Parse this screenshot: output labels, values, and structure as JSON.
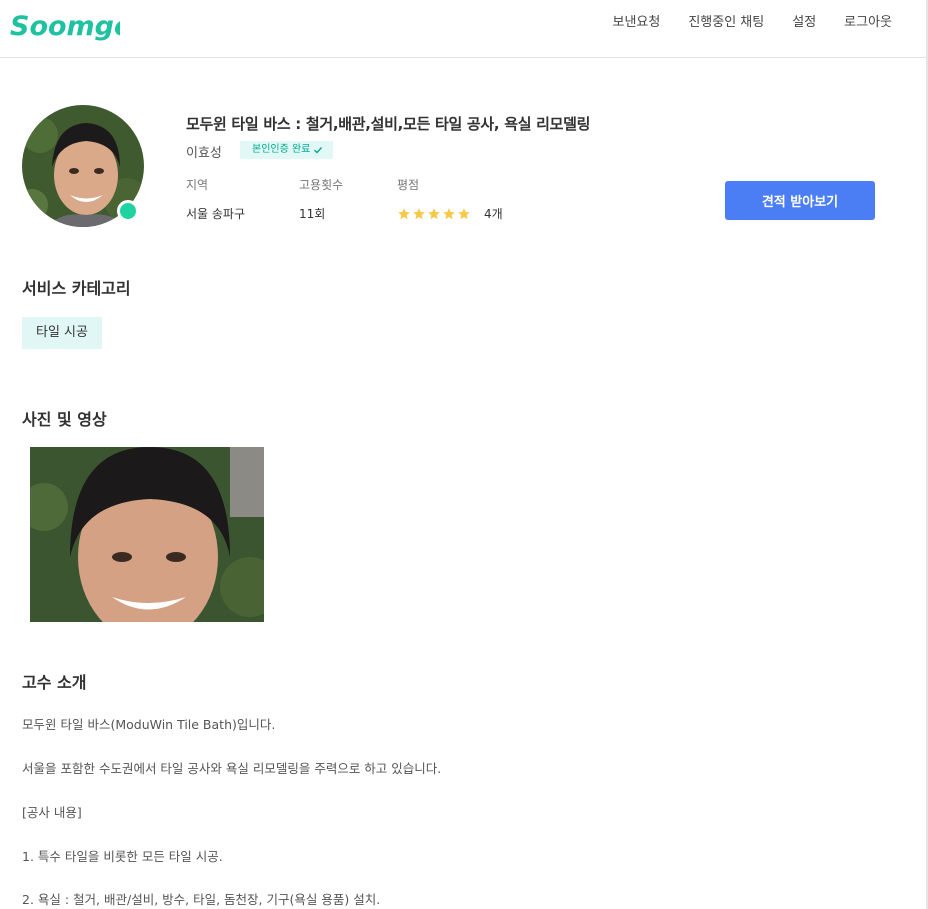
{
  "header": {
    "logo_text": "Soomgo",
    "nav": [
      "보낸요청",
      "진행중인 채팅",
      "설정",
      "로그아웃"
    ]
  },
  "profile": {
    "title": "모두윈 타일 바스 : 철거,배관,설비,모든 타일 공사, 욕실 리모델링",
    "name": "이효성",
    "verify_label": "본인인증 완료",
    "stats": {
      "region_label": "지역",
      "region_value": "서울 송파구",
      "hires_label": "고용횟수",
      "hires_value": "11회",
      "rating_label": "평점",
      "rating_stars": 5,
      "review_count": "4개"
    },
    "quote_button": "견적 받아보기"
  },
  "sections": {
    "category_title": "서비스 카테고리",
    "category_chip": "타일 시공",
    "media_title": "사진 및 영상",
    "intro_title": "고수 소개"
  },
  "intro_lines": [
    "모두윈 타일 바스(ModuWin Tile Bath)입니다.",
    "서울을 포함한 수도권에서 타일 공사와 욕실 리모델링을 주력으로 하고 있습니다.",
    "[공사 내용]",
    "1. 특수 타일을 비롯한 모든 타일 시공.",
    "2. 욕실 : 철거, 배관/설비, 방수, 타일, 돔천장, 기구(욕실 용품) 설치."
  ],
  "colors": {
    "brand": "#1fc2a0",
    "accent_button": "#4b7df4",
    "badge_bg": "#e2f8f6",
    "star": "#f7c948"
  }
}
